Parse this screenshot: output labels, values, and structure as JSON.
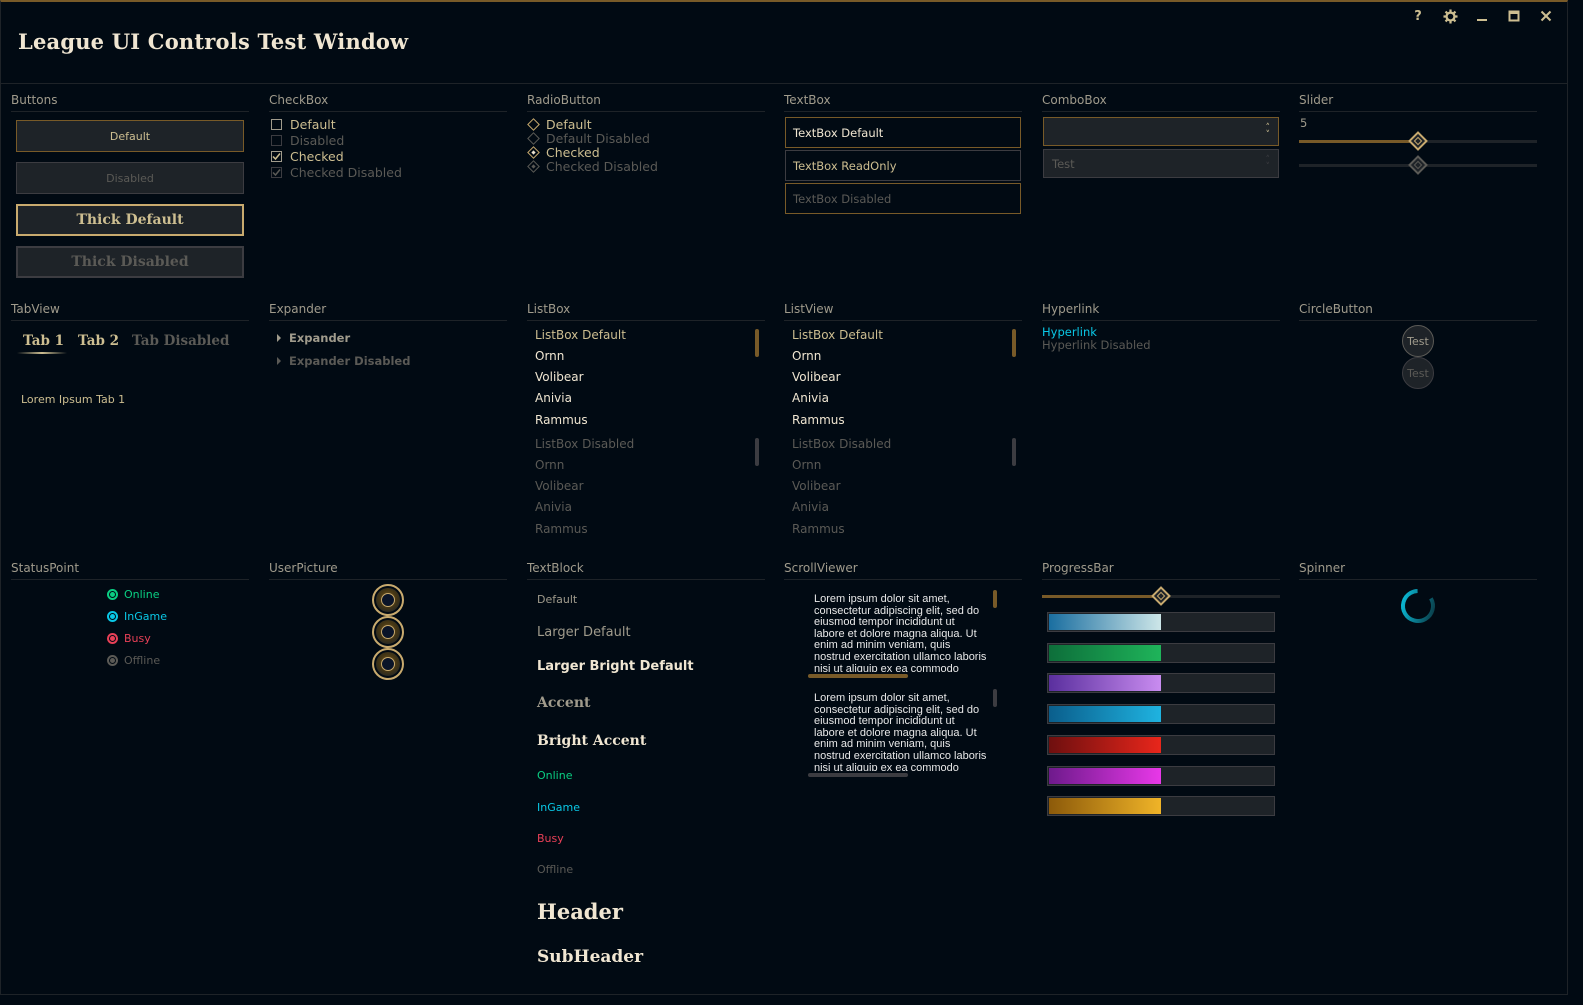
{
  "window": {
    "title": "League UI Controls Test Window",
    "controls": [
      "help-icon",
      "gear-icon",
      "minimize-icon",
      "maximize-icon",
      "close-icon"
    ],
    "help_label": "?"
  },
  "sections": {
    "buttons": "Buttons",
    "checkbox": "CheckBox",
    "radio": "RadioButton",
    "textbox": "TextBox",
    "combobox": "ComboBox",
    "slider": "Slider",
    "tabview": "TabView",
    "expander": "Expander",
    "listbox": "ListBox",
    "listview": "ListView",
    "hyperlink": "Hyperlink",
    "circlebutton": "CircleButton",
    "statuspoint": "StatusPoint",
    "userpicture": "UserPicture",
    "textblock": "TextBlock",
    "scrollviewer": "ScrollViewer",
    "progressbar": "ProgressBar",
    "spinner": "Spinner"
  },
  "buttons": {
    "default": "Default",
    "disabled": "Disabled",
    "thick_default": "Thick Default",
    "thick_disabled": "Thick Disabled"
  },
  "checkbox": {
    "default": "Default",
    "disabled": "Disabled",
    "checked": "Checked",
    "checked_disabled": "Checked Disabled"
  },
  "radio": {
    "default": "Default",
    "default_disabled": "Default Disabled",
    "checked": "Checked",
    "checked_disabled": "Checked Disabled"
  },
  "textbox": {
    "default": "TextBox Default",
    "readonly": "TextBox ReadOnly",
    "disabled": "TextBox Disabled"
  },
  "combobox": {
    "value": "",
    "disabled_value": "Test"
  },
  "slider": {
    "value_label": "5",
    "value": 0.5,
    "disabled_value": 0.5
  },
  "tabview": {
    "tabs": [
      "Tab 1",
      "Tab 2",
      "Tab Disabled"
    ],
    "content": "Lorem Ipsum Tab 1"
  },
  "expander": {
    "default": "Expander",
    "disabled": "Expander Disabled"
  },
  "listbox": {
    "items": [
      "ListBox Default",
      "Ornn",
      "Volibear",
      "Anivia",
      "Rammus"
    ],
    "disabled_items": [
      "ListBox Disabled",
      "Ornn",
      "Volibear",
      "Anivia",
      "Rammus"
    ]
  },
  "listview": {
    "items": [
      "ListBox Default",
      "Ornn",
      "Volibear",
      "Anivia",
      "Rammus"
    ],
    "disabled_items": [
      "ListBox Disabled",
      "Ornn",
      "Volibear",
      "Anivia",
      "Rammus"
    ]
  },
  "hyperlink": {
    "default": "Hyperlink",
    "disabled": "Hyperlink Disabled"
  },
  "circlebutton": {
    "default": "Test",
    "disabled": "Test"
  },
  "status": {
    "online": "Online",
    "ingame": "InGame",
    "busy": "Busy",
    "offline": "Offline"
  },
  "textblock": {
    "default": "Default",
    "larger": "Larger Default",
    "larger_bright": "Larger Bright Default",
    "accent": "Accent",
    "bright_accent": "Bright Accent",
    "online": "Online",
    "ingame": "InGame",
    "busy": "Busy",
    "offline": "Offline",
    "header": "Header",
    "subheader": "SubHeader"
  },
  "scrollviewer": {
    "text": "Lorem ipsum dolor sit amet, consectetur adipiscing elit, sed do eiusmod tempor incididunt ut labore et dolore magna aliqua. Ut enim ad minim veniam, quis nostrud exercitation ullamco laboris nisi ut aliquip ex ea commodo consequat. Duis aute irure dolor in reprehenderit in voluptate velit esse cillum dolore eu fugiat nulla pariatur. Excepteur sint occaecat cupidatat non proident, sunt in culpa qui officia deserunt mollit anim id est laborum."
  },
  "progressbar": {
    "slider_value": 0.5,
    "bars": [
      {
        "value": 0.5,
        "from": "#1a6ea0",
        "to": "#cde6e8"
      },
      {
        "value": 0.5,
        "from": "#0d6e3a",
        "to": "#1fb45a"
      },
      {
        "value": 0.5,
        "from": "#5a2f9e",
        "to": "#c98cf0"
      },
      {
        "value": 0.5,
        "from": "#0a5e8c",
        "to": "#1fb3e0"
      },
      {
        "value": 0.5,
        "from": "#6e0f0f",
        "to": "#e8261b"
      },
      {
        "value": 0.5,
        "from": "#6e1a8c",
        "to": "#e838e8"
      },
      {
        "value": 0.5,
        "from": "#8c5a0a",
        "to": "#f0b428"
      }
    ]
  },
  "colors": {
    "gold": "#c8aa6e",
    "gold_dark": "#785a28",
    "text_gold": "#cdbe91",
    "bright": "#f0e6d2",
    "online": "#0acf83",
    "ingame": "#0ac8e6",
    "busy": "#e84057",
    "offline": "#5b5a56",
    "hyperlink": "#0ac8e6"
  }
}
